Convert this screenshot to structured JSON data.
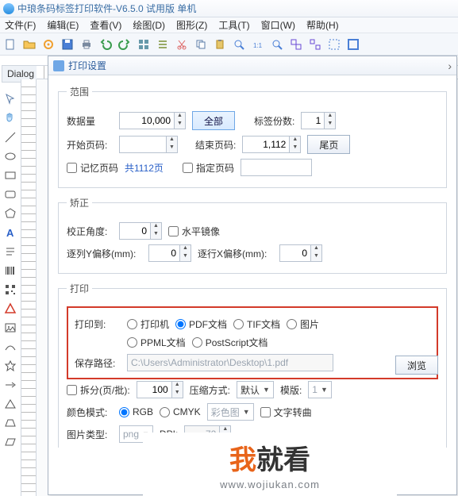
{
  "window": {
    "title": "中琅条码标签打印软件-V6.5.0 试用版 单机"
  },
  "menu": {
    "file": "文件(F)",
    "edit": "编辑(E)",
    "view": "查看(V)",
    "draw": "绘图(D)",
    "shape": "图形(Z)",
    "tool": "工具(T)",
    "window": "窗口(W)",
    "help": "帮助(H)"
  },
  "dialog": {
    "title": "打印设置",
    "range": {
      "legend": "范围",
      "data_qty_label": "数据量",
      "data_qty": "10,000",
      "all_btn": "全部",
      "copies_label": "标签份数:",
      "copies": "1",
      "start_label": "开始页码:",
      "start": "",
      "end_label": "结束页码:",
      "end": "1,112",
      "last_btn": "尾页",
      "remember": "记忆页码",
      "total_pages": "共1112页",
      "spec_page": "指定页码",
      "spec_page_val": ""
    },
    "adjust": {
      "legend": "矫正",
      "angle_label": "校正角度:",
      "angle": "0",
      "mirror": "水平镜像",
      "col_label": "逐列Y偏移(mm):",
      "col": "0",
      "row_label": "逐行X偏移(mm):",
      "row": "0"
    },
    "print": {
      "legend": "打印",
      "to_label": "打印到:",
      "opt_printer": "打印机",
      "opt_pdf": "PDF文档",
      "opt_tif": "TIF文档",
      "opt_img": "图片",
      "opt_ppml": "PPML文档",
      "opt_ps": "PostScript文档",
      "path_label": "保存路径:",
      "path": "C:\\Users\\Administrator\\Desktop\\1.pdf",
      "browse": "浏览",
      "split": "拆分(页/批):",
      "split_val": "100",
      "compress_label": "压缩方式:",
      "compress_val": "默认",
      "tpl_label": "模版:",
      "tpl_val": "1",
      "color_label": "颜色模式:",
      "rgb": "RGB",
      "cmyk": "CMYK",
      "color_img": "彩色图",
      "text_out": "文字转曲",
      "img_type_label": "图片类型:",
      "img_type": "png",
      "dpi_label": "DPI:",
      "dpi_val": "72"
    }
  },
  "left_panel": "Dialog",
  "watermark": {
    "t1": "我",
    "t2": "就看",
    "url": "www.wojiukan.com"
  }
}
